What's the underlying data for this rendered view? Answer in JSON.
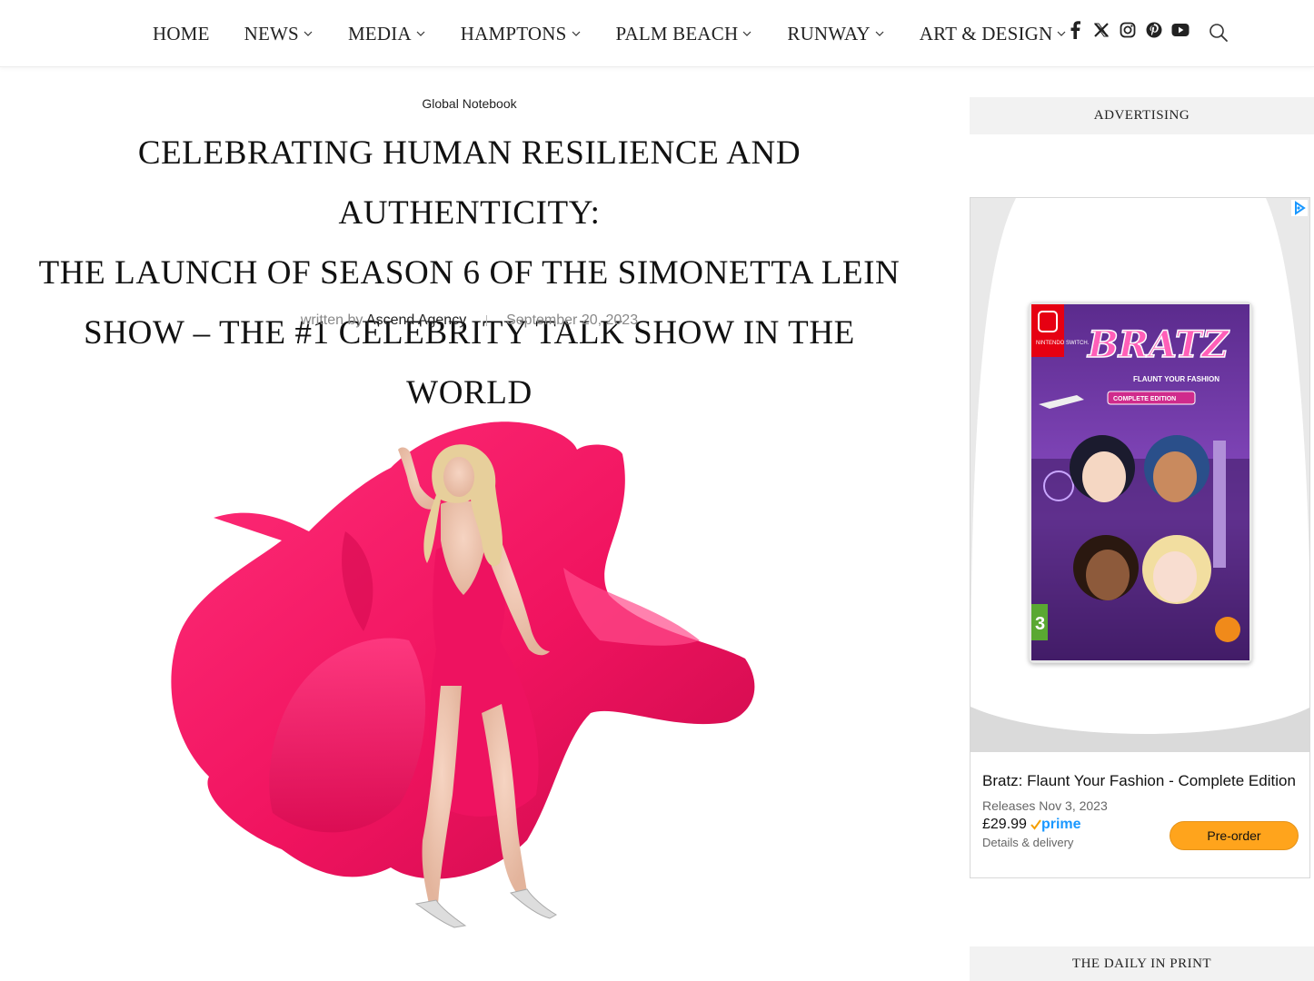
{
  "nav": {
    "items": [
      {
        "label": "HOME",
        "dropdown": false
      },
      {
        "label": "NEWS",
        "dropdown": true
      },
      {
        "label": "MEDIA",
        "dropdown": true
      },
      {
        "label": "HAMPTONS",
        "dropdown": true
      },
      {
        "label": "PALM BEACH",
        "dropdown": true
      },
      {
        "label": "RUNWAY",
        "dropdown": true
      },
      {
        "label": "ART & DESIGN",
        "dropdown": true
      }
    ],
    "social_icons": [
      "facebook-icon",
      "x-icon",
      "instagram-icon",
      "pinterest-icon",
      "youtube-icon"
    ],
    "search_icon": "search-icon"
  },
  "article": {
    "category": "Global Notebook",
    "title_lines": [
      "Celebrating Human Resilience and Authenticity:",
      "The Launch of Season 6 of The Simonetta Lein",
      "Show – The #1 Celebrity Talk Show in the World"
    ],
    "written_by": "written by",
    "author": "Ascend Agency",
    "date": "September 20, 2023"
  },
  "sidebar": {
    "advertising_label": "ADVERTISING",
    "ad": {
      "title": "Bratz: Flaunt Your Fashion - Complete Edition",
      "release": "Releases Nov 3, 2023",
      "price": "£29.99",
      "prime_label": "prime",
      "delivery": "Details & delivery",
      "button": "Pre-order",
      "box_brand": "NINTENDO SWITCH.",
      "box_logo": "BRATZ",
      "box_subtitle": "FLAUNT YOUR FASHION",
      "box_edition": "COMPLETE EDITION",
      "box_rating": "3"
    },
    "daily_in_print_label": "THE DAILY IN PRINT"
  },
  "colors": {
    "accent_pink": "#f0135f",
    "prime_blue": "#1a98ff",
    "preorder_orange": "#ffa41c"
  }
}
